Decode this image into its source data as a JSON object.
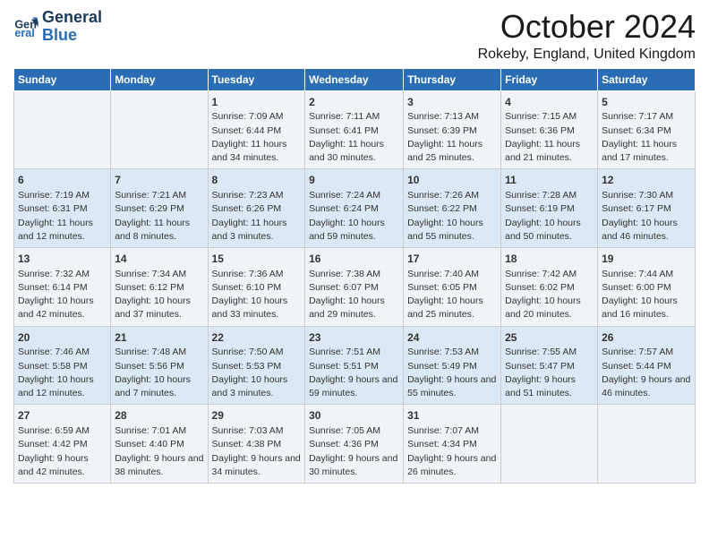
{
  "header": {
    "logo_line1": "General",
    "logo_line2": "Blue",
    "month": "October 2024",
    "location": "Rokeby, England, United Kingdom"
  },
  "days_of_week": [
    "Sunday",
    "Monday",
    "Tuesday",
    "Wednesday",
    "Thursday",
    "Friday",
    "Saturday"
  ],
  "weeks": [
    [
      {
        "day": "",
        "content": ""
      },
      {
        "day": "",
        "content": ""
      },
      {
        "day": "1",
        "content": "Sunrise: 7:09 AM\nSunset: 6:44 PM\nDaylight: 11 hours and 34 minutes."
      },
      {
        "day": "2",
        "content": "Sunrise: 7:11 AM\nSunset: 6:41 PM\nDaylight: 11 hours and 30 minutes."
      },
      {
        "day": "3",
        "content": "Sunrise: 7:13 AM\nSunset: 6:39 PM\nDaylight: 11 hours and 25 minutes."
      },
      {
        "day": "4",
        "content": "Sunrise: 7:15 AM\nSunset: 6:36 PM\nDaylight: 11 hours and 21 minutes."
      },
      {
        "day": "5",
        "content": "Sunrise: 7:17 AM\nSunset: 6:34 PM\nDaylight: 11 hours and 17 minutes."
      }
    ],
    [
      {
        "day": "6",
        "content": "Sunrise: 7:19 AM\nSunset: 6:31 PM\nDaylight: 11 hours and 12 minutes."
      },
      {
        "day": "7",
        "content": "Sunrise: 7:21 AM\nSunset: 6:29 PM\nDaylight: 11 hours and 8 minutes."
      },
      {
        "day": "8",
        "content": "Sunrise: 7:23 AM\nSunset: 6:26 PM\nDaylight: 11 hours and 3 minutes."
      },
      {
        "day": "9",
        "content": "Sunrise: 7:24 AM\nSunset: 6:24 PM\nDaylight: 10 hours and 59 minutes."
      },
      {
        "day": "10",
        "content": "Sunrise: 7:26 AM\nSunset: 6:22 PM\nDaylight: 10 hours and 55 minutes."
      },
      {
        "day": "11",
        "content": "Sunrise: 7:28 AM\nSunset: 6:19 PM\nDaylight: 10 hours and 50 minutes."
      },
      {
        "day": "12",
        "content": "Sunrise: 7:30 AM\nSunset: 6:17 PM\nDaylight: 10 hours and 46 minutes."
      }
    ],
    [
      {
        "day": "13",
        "content": "Sunrise: 7:32 AM\nSunset: 6:14 PM\nDaylight: 10 hours and 42 minutes."
      },
      {
        "day": "14",
        "content": "Sunrise: 7:34 AM\nSunset: 6:12 PM\nDaylight: 10 hours and 37 minutes."
      },
      {
        "day": "15",
        "content": "Sunrise: 7:36 AM\nSunset: 6:10 PM\nDaylight: 10 hours and 33 minutes."
      },
      {
        "day": "16",
        "content": "Sunrise: 7:38 AM\nSunset: 6:07 PM\nDaylight: 10 hours and 29 minutes."
      },
      {
        "day": "17",
        "content": "Sunrise: 7:40 AM\nSunset: 6:05 PM\nDaylight: 10 hours and 25 minutes."
      },
      {
        "day": "18",
        "content": "Sunrise: 7:42 AM\nSunset: 6:02 PM\nDaylight: 10 hours and 20 minutes."
      },
      {
        "day": "19",
        "content": "Sunrise: 7:44 AM\nSunset: 6:00 PM\nDaylight: 10 hours and 16 minutes."
      }
    ],
    [
      {
        "day": "20",
        "content": "Sunrise: 7:46 AM\nSunset: 5:58 PM\nDaylight: 10 hours and 12 minutes."
      },
      {
        "day": "21",
        "content": "Sunrise: 7:48 AM\nSunset: 5:56 PM\nDaylight: 10 hours and 7 minutes."
      },
      {
        "day": "22",
        "content": "Sunrise: 7:50 AM\nSunset: 5:53 PM\nDaylight: 10 hours and 3 minutes."
      },
      {
        "day": "23",
        "content": "Sunrise: 7:51 AM\nSunset: 5:51 PM\nDaylight: 9 hours and 59 minutes."
      },
      {
        "day": "24",
        "content": "Sunrise: 7:53 AM\nSunset: 5:49 PM\nDaylight: 9 hours and 55 minutes."
      },
      {
        "day": "25",
        "content": "Sunrise: 7:55 AM\nSunset: 5:47 PM\nDaylight: 9 hours and 51 minutes."
      },
      {
        "day": "26",
        "content": "Sunrise: 7:57 AM\nSunset: 5:44 PM\nDaylight: 9 hours and 46 minutes."
      }
    ],
    [
      {
        "day": "27",
        "content": "Sunrise: 6:59 AM\nSunset: 4:42 PM\nDaylight: 9 hours and 42 minutes."
      },
      {
        "day": "28",
        "content": "Sunrise: 7:01 AM\nSunset: 4:40 PM\nDaylight: 9 hours and 38 minutes."
      },
      {
        "day": "29",
        "content": "Sunrise: 7:03 AM\nSunset: 4:38 PM\nDaylight: 9 hours and 34 minutes."
      },
      {
        "day": "30",
        "content": "Sunrise: 7:05 AM\nSunset: 4:36 PM\nDaylight: 9 hours and 30 minutes."
      },
      {
        "day": "31",
        "content": "Sunrise: 7:07 AM\nSunset: 4:34 PM\nDaylight: 9 hours and 26 minutes."
      },
      {
        "day": "",
        "content": ""
      },
      {
        "day": "",
        "content": ""
      }
    ]
  ]
}
